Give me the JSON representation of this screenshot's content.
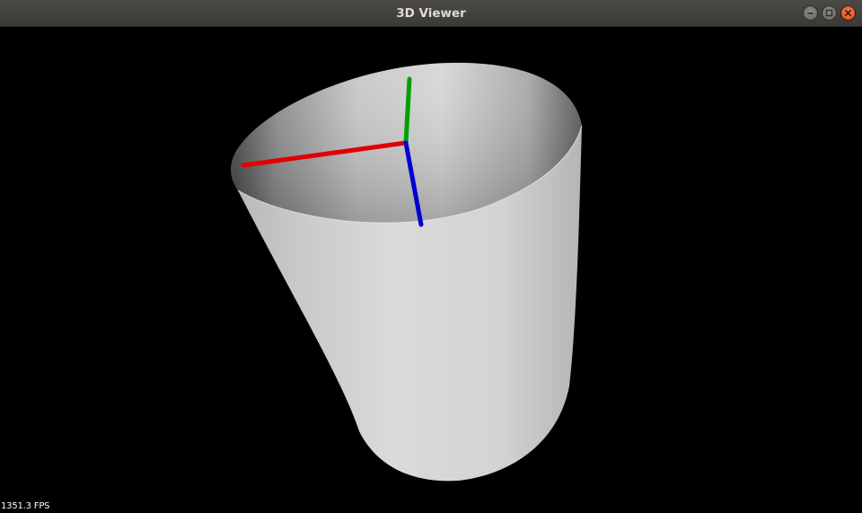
{
  "window": {
    "title": "3D Viewer",
    "controls": {
      "minimize_icon": "minimize-icon",
      "maximize_icon": "maximize-icon",
      "close_icon": "close-icon"
    }
  },
  "viewport": {
    "background": "#000000",
    "model": "cylinder-mesh",
    "axes": {
      "x_color": "#e00000",
      "y_color": "#00a000",
      "z_color": "#0000d0"
    }
  },
  "status": {
    "fps": "1351.3 FPS"
  }
}
